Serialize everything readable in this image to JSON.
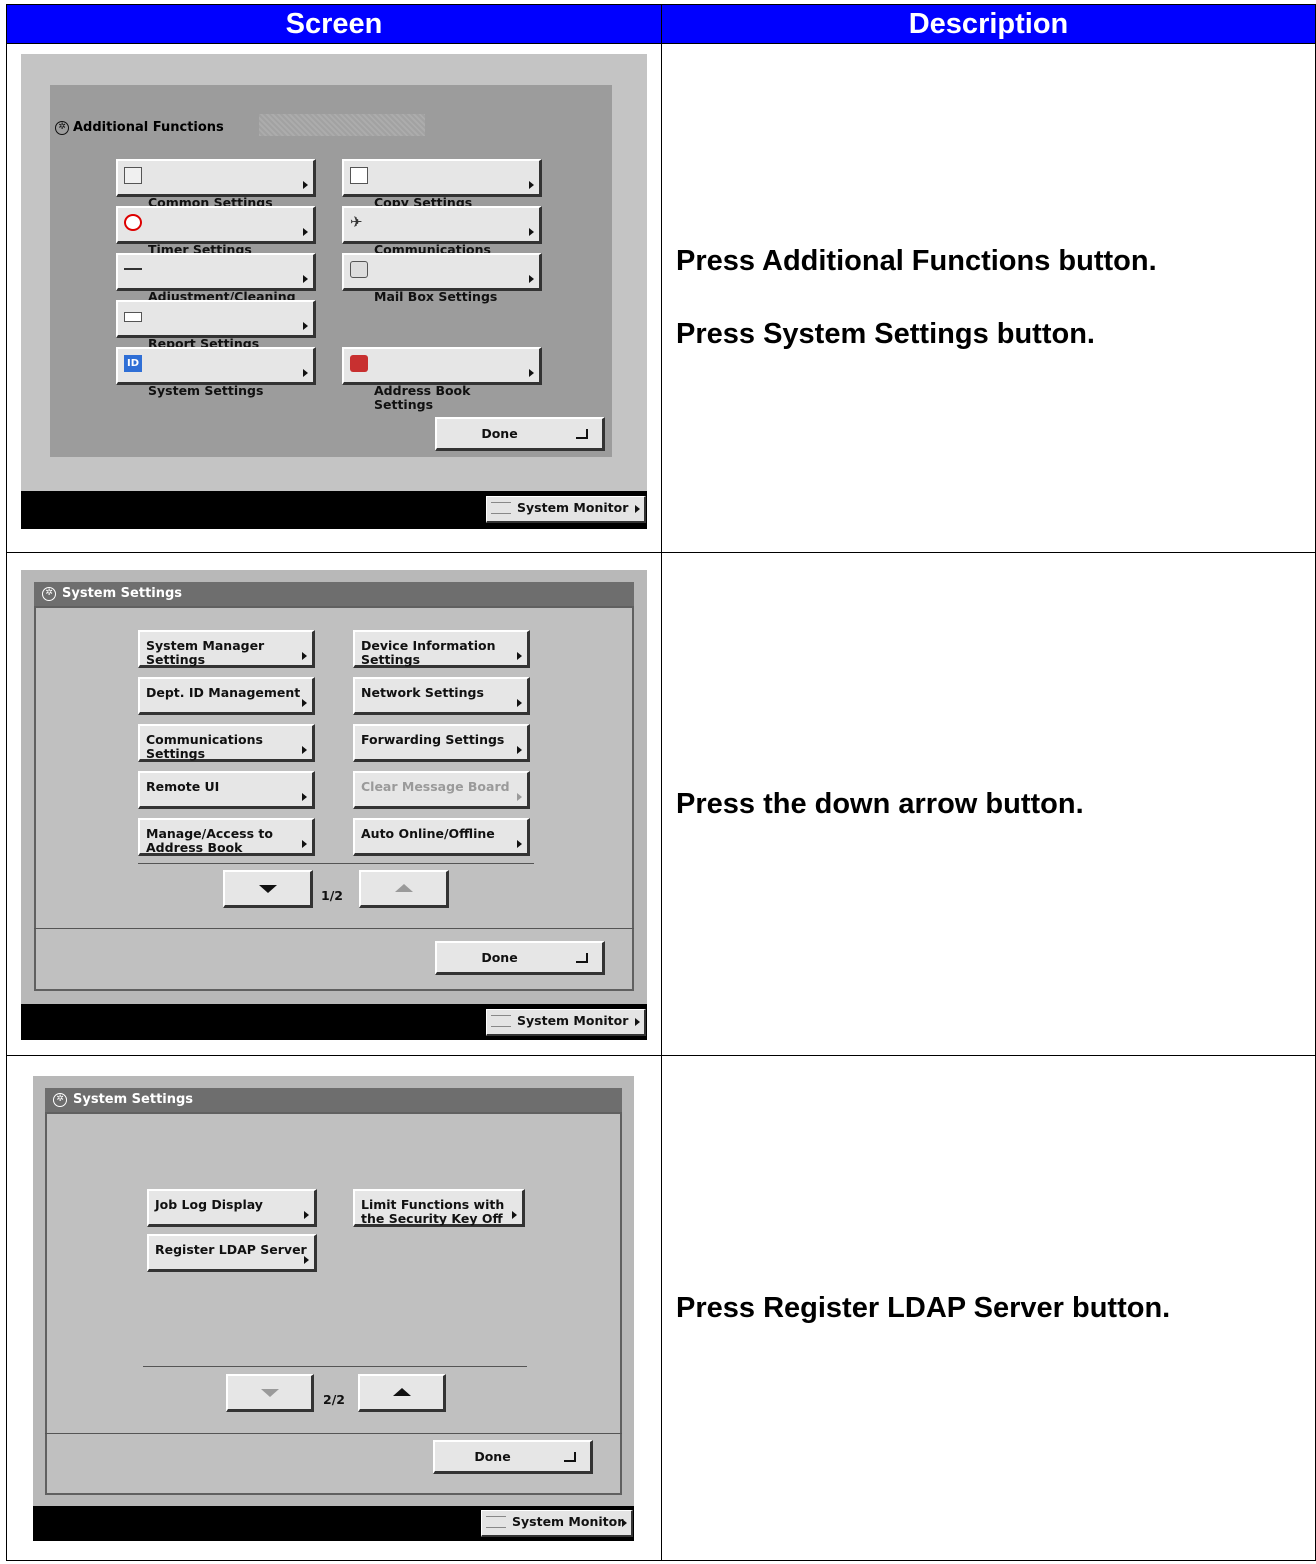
{
  "headers": {
    "screen": "Screen",
    "description": "Description"
  },
  "rows": [
    {
      "screen": {
        "title": "Additional Functions",
        "buttons": {
          "common": "Common Settings",
          "copy": "Copy Settings",
          "timer": "Timer Settings",
          "communications": "Communications\nSettings",
          "adjustment": "Adjustment/Cleaning",
          "mailbox": "Mail Box Settings",
          "report": "Report Settings",
          "system": "System Settings",
          "address": "Address Book Settings"
        },
        "done": "Done",
        "system_monitor": "System Monitor"
      },
      "description": [
        "Press Additional Functions button.",
        "Press System Settings button."
      ]
    },
    {
      "screen": {
        "title": "System Settings",
        "buttons": {
          "system_manager": "System Manager\nSettings",
          "device_info": "Device Information\nSettings",
          "dept_id": "Dept. ID Management",
          "network": "Network Settings",
          "communications": "Communications\nSettings",
          "forwarding": "Forwarding Settings",
          "remote_ui": "Remote UI",
          "clear_message": "Clear Message Board",
          "manage_address": "Manage/Access to\nAddress Book",
          "auto_online": "Auto Online/Offline"
        },
        "page": "1/2",
        "done": "Done",
        "system_monitor": "System Monitor"
      },
      "description": [
        "Press the down arrow button."
      ]
    },
    {
      "screen": {
        "title": "System Settings",
        "buttons": {
          "job_log": "Job Log Display",
          "limit_functions": "Limit Functions with\nthe Security Key Off",
          "register_ldap": "Register LDAP Server"
        },
        "page": "2/2",
        "done": "Done",
        "system_monitor": "System Monitor"
      },
      "description": [
        "Press Register LDAP Server button."
      ]
    }
  ]
}
